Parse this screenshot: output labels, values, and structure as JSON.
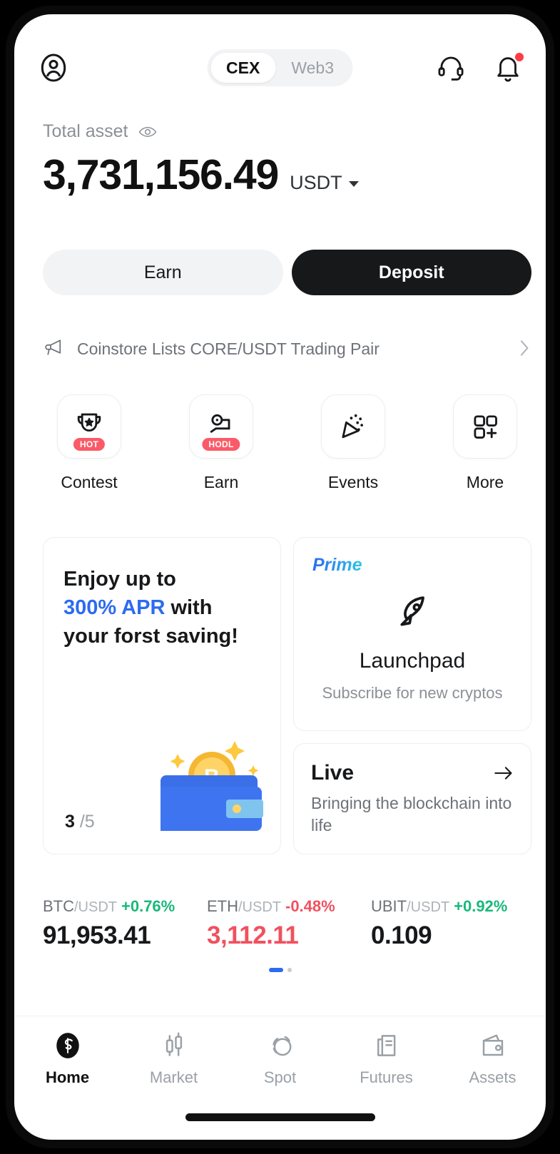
{
  "header": {
    "profile_icon": "user-circle-icon",
    "tabs": [
      {
        "label": "CEX",
        "active": true
      },
      {
        "label": "Web3",
        "active": false
      }
    ],
    "support_icon": "headset-icon",
    "notification_icon": "bell-icon",
    "notification_has_badge": true
  },
  "balance": {
    "label": "Total asset",
    "visibility_icon": "eye-icon",
    "amount": "3,731,156.49",
    "currency": "USDT",
    "currency_caret": "chevron-down-icon"
  },
  "actions": {
    "earn_label": "Earn",
    "deposit_label": "Deposit"
  },
  "announcement": {
    "icon": "megaphone-icon",
    "text": "Coinstore Lists CORE/USDT Trading Pair",
    "chevron": "chevron-right-icon"
  },
  "quick_actions": [
    {
      "label": "Contest",
      "icon": "trophy-icon",
      "badge": "HOT"
    },
    {
      "label": "Earn",
      "icon": "coin-hand-icon",
      "badge": "HODL"
    },
    {
      "label": "Events",
      "icon": "confetti-icon",
      "badge": ""
    },
    {
      "label": "More",
      "icon": "grid-plus-icon",
      "badge": ""
    }
  ],
  "promo_card": {
    "line1": "Enjoy up to",
    "accent": "300% APR",
    "line2_rest": " with",
    "line3": "your forst saving!",
    "carousel_current": "3",
    "carousel_total": "/5",
    "art": "wallet-bitcoin-illustration"
  },
  "prime_card": {
    "tag": "Prime",
    "icon": "rocket-icon",
    "title": "Launchpad",
    "subtitle": "Subscribe for new cryptos"
  },
  "live_card": {
    "title": "Live",
    "arrow": "arrow-right-icon",
    "subtitle": "Bringing the blockchain into life"
  },
  "tickers": [
    {
      "base": "BTC",
      "quote": "/USDT",
      "change": "+0.76%",
      "direction": "up",
      "price": "91,953.41",
      "price_color": "neutral"
    },
    {
      "base": "ETH",
      "quote": "/USDT",
      "change": "-0.48%",
      "direction": "down",
      "price": "3,112.11",
      "price_color": "down"
    },
    {
      "base": "UBIT",
      "quote": "/USDT",
      "change": "+0.92%",
      "direction": "up",
      "price": "0.109",
      "price_color": "neutral"
    }
  ],
  "pager": {
    "active_index": 0,
    "count": 2
  },
  "bottom_nav": [
    {
      "label": "Home",
      "icon": "home-logo-icon",
      "active": true
    },
    {
      "label": "Market",
      "icon": "candlestick-icon",
      "active": false
    },
    {
      "label": "Spot",
      "icon": "swap-circles-icon",
      "active": false
    },
    {
      "label": "Futures",
      "icon": "document-icon",
      "active": false
    },
    {
      "label": "Assets",
      "icon": "wallet-icon",
      "active": false
    }
  ],
  "colors": {
    "accent_blue": "#2d6bf0",
    "up_green": "#19b87a",
    "down_red": "#f0515f",
    "badge_red": "#fb5a68",
    "dark": "#17181a"
  }
}
